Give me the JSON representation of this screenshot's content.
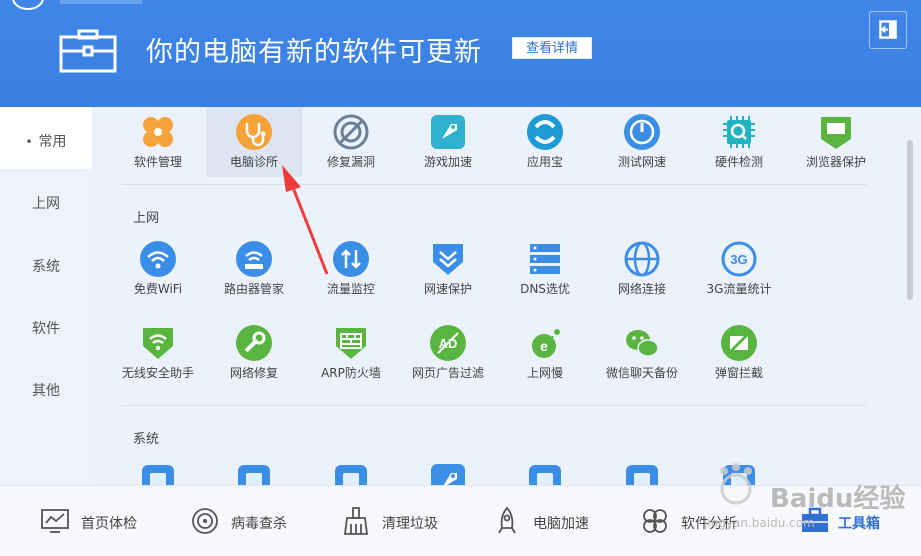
{
  "header": {
    "title": "你的电脑有新的软件可更新",
    "detail_button": "查看详情",
    "exit_icon": "exit-icon",
    "bg_color": "#3a7fe2"
  },
  "sidebar": {
    "items": [
      {
        "label": "常用",
        "active": true
      },
      {
        "label": "上网"
      },
      {
        "label": "系统"
      },
      {
        "label": "软件"
      },
      {
        "label": "其他"
      }
    ]
  },
  "common_tools": [
    {
      "label": "软件管理",
      "icon": "clover-icon",
      "color": "#f7a23b"
    },
    {
      "label": "电脑诊所",
      "icon": "stethoscope-icon",
      "color": "#f7a23b",
      "selected": true
    },
    {
      "label": "修复漏洞",
      "icon": "patch-shield-icon",
      "color": "#6a7f99"
    },
    {
      "label": "游戏加速",
      "icon": "rocket-icon",
      "color": "#2fb2cf"
    },
    {
      "label": "应用宝",
      "icon": "app-treasure-icon",
      "color": "#1e9ad6"
    },
    {
      "label": "测试网速",
      "icon": "speedometer-icon",
      "color": "#3b8ee8"
    },
    {
      "label": "硬件检测",
      "icon": "chip-icon",
      "color": "#20b3c2"
    },
    {
      "label": "浏览器保护",
      "icon": "browser-shield-icon",
      "color": "#5ab540"
    }
  ],
  "sections": [
    {
      "title": "上网",
      "rows": [
        [
          {
            "label": "免费WiFi",
            "icon": "wifi-icon",
            "color": "#3b8ee8"
          },
          {
            "label": "路由器管家",
            "icon": "router-icon",
            "color": "#3b8ee8"
          },
          {
            "label": "流量监控",
            "icon": "traffic-icon",
            "color": "#3b8ee8"
          },
          {
            "label": "网速保护",
            "icon": "speed-shield-icon",
            "color": "#3b8ee8"
          },
          {
            "label": "DNS选优",
            "icon": "server-icon",
            "color": "#3b8ee8"
          },
          {
            "label": "网络连接",
            "icon": "globe-icon",
            "color": "#3b8ee8"
          },
          {
            "label": "3G流量统计",
            "icon": "3g-icon",
            "color": "#3b8ee8",
            "icon_text": "3G"
          }
        ],
        [
          {
            "label": "无线安全助手",
            "icon": "wifi-shield-icon",
            "color": "#5ab540"
          },
          {
            "label": "网络修复",
            "icon": "wrench-icon",
            "color": "#5ab540"
          },
          {
            "label": "ARP防火墙",
            "icon": "firewall-icon",
            "color": "#5ab540"
          },
          {
            "label": "网页广告过滤",
            "icon": "ad-block-icon",
            "color": "#5ab540",
            "icon_text": "AD"
          },
          {
            "label": "上网慢",
            "icon": "slow-browser-icon",
            "color": "#5ab540"
          },
          {
            "label": "微信聊天备份",
            "icon": "wechat-icon",
            "color": "#5ab540"
          },
          {
            "label": "弹窗拦截",
            "icon": "popup-block-icon",
            "color": "#5ab540"
          }
        ]
      ]
    },
    {
      "title": "系统",
      "rows": [
        [
          {
            "label": "",
            "icon": "check-icon",
            "color": "#3b8ee8"
          },
          {
            "label": "",
            "icon": "trash-icon",
            "color": "#3b8ee8"
          },
          {
            "label": "",
            "icon": "eraser-icon",
            "color": "#3b8ee8"
          },
          {
            "label": "",
            "icon": "rocket-icon",
            "color": "#3b8ee8"
          },
          {
            "label": "",
            "icon": "puzzle-icon",
            "color": "#3b8ee8"
          },
          {
            "label": "",
            "icon": "delete-icon",
            "color": "#3b8ee8"
          },
          {
            "label": "",
            "icon": "sys-icon",
            "color": "#3b8ee8"
          }
        ]
      ]
    }
  ],
  "bottom_nav": [
    {
      "label": "首页体检",
      "icon": "monitor-chart-icon"
    },
    {
      "label": "病毒查杀",
      "icon": "target-icon"
    },
    {
      "label": "清理垃圾",
      "icon": "broom-icon"
    },
    {
      "label": "电脑加速",
      "icon": "rocket-icon"
    },
    {
      "label": "软件分析",
      "icon": "clover-icon"
    },
    {
      "label": "工具箱",
      "icon": "toolbox-icon",
      "active": true
    }
  ],
  "watermark": {
    "text": "Baidu经验",
    "sub": "jingyan.baidu.com"
  }
}
